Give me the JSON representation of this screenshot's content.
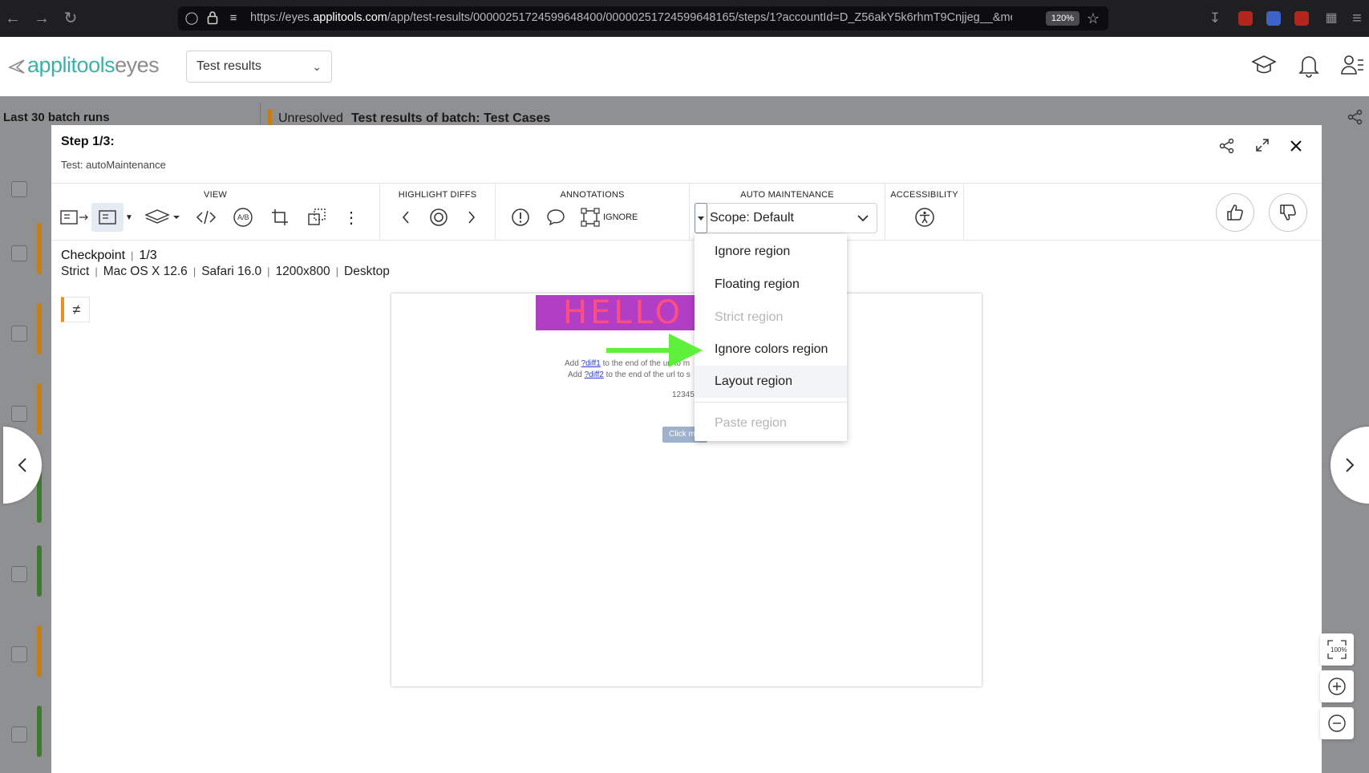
{
  "browser": {
    "url_prefix": "https://eyes.",
    "url_domain": "applitools.com",
    "url_rest": "/app/test-results/00000251724599648400/00000251724599648165/steps/1?accountId=D_Z56akY5k6rhmT9Cnjjeg__&mo",
    "zoom": "120%"
  },
  "header": {
    "logo_brand": "applitools",
    "logo_product": "eyes",
    "view_select": "Test results"
  },
  "background": {
    "sidebar_title": "Last 30 batch runs",
    "status": "Unresolved",
    "batch_title": "Test results of batch:  Test Cases"
  },
  "modal": {
    "title": "Step 1/3:",
    "subtitle": "Test: autoMaintenance",
    "toolbar": {
      "view_label": "VIEW",
      "highlight_label": "HIGHLIGHT DIFFS",
      "annotations_label": "ANNOTATIONS",
      "ignore_label": "IGNORE",
      "auto_maintenance_label": "AUTO MAINTENANCE",
      "scope_value": "Scope: Default",
      "accessibility_label": "ACCESSIBILITY"
    },
    "checkpoint": {
      "title": "Checkpoint",
      "index": "1/3",
      "match_level": "Strict",
      "os": "Mac OS X 12.6",
      "browser": "Safari 16.0",
      "viewport": "1200x800",
      "device": "Desktop"
    },
    "diff_symbol": "≠",
    "screenshot": {
      "hello_text": "HELLO W",
      "line1_prefix": "Add ",
      "line1_link": "?diff1",
      "line1_suffix": " to the end of the url to m",
      "line2_prefix": "Add ",
      "line2_link": "?diff2",
      "line2_suffix": " to the end of the url to s",
      "number": "12345",
      "button": "Click m"
    },
    "region_menu": [
      {
        "label": "Ignore region",
        "enabled": true
      },
      {
        "label": "Floating region",
        "enabled": true
      },
      {
        "label": "Strict region",
        "enabled": false
      },
      {
        "label": "Ignore colors region",
        "enabled": true
      },
      {
        "label": "Layout region",
        "enabled": true
      },
      {
        "label": "Paste region",
        "enabled": false
      }
    ],
    "zoom_fit_label": "100%"
  },
  "colors": {
    "brand_teal": "#3cb2a8",
    "unresolved_orange": "#c67f14",
    "annotation_arrow": "#5ef03a",
    "diff_marker": "#ef8f1f"
  }
}
